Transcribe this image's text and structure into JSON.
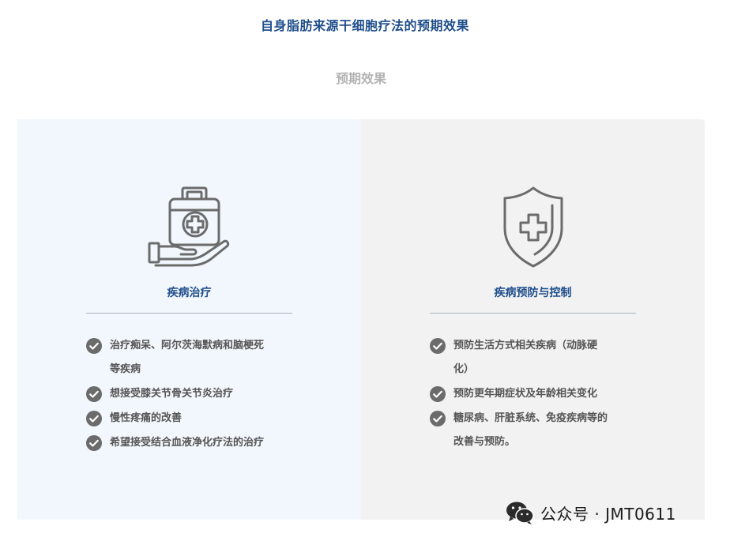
{
  "header": {
    "title": "自身脂肪来源干细胞疗法的预期效果",
    "subtitle": "预期效果"
  },
  "left_panel": {
    "icon": "medical-kit-hand-icon",
    "heading": "疾病治疗",
    "items": [
      [
        "治疗痴呆、阿尔茨海默病和脑梗死",
        "等疾病"
      ],
      [
        "想接受膝关节骨关节炎治疗"
      ],
      [
        "慢性疼痛的改善"
      ],
      [
        "希望接受结合血液净化疗法的治疗"
      ]
    ]
  },
  "right_panel": {
    "icon": "shield-cross-icon",
    "heading": "疾病预防与控制",
    "items": [
      [
        "预防生活方式相关疾病（动脉硬",
        "化）"
      ],
      [
        "预防更年期症状及年龄相关变化"
      ],
      [
        "糖尿病、肝脏系统、免疫疾病等的",
        "改善与预防。"
      ]
    ]
  },
  "watermark": {
    "icon": "wechat-icon",
    "text": "公众号 · JMT0611"
  },
  "colors": {
    "accent": "#1f4e8c",
    "left_bg": "#f2f7fd",
    "right_bg": "#f2f2f2",
    "icon_gray": "#6b6b6b"
  }
}
